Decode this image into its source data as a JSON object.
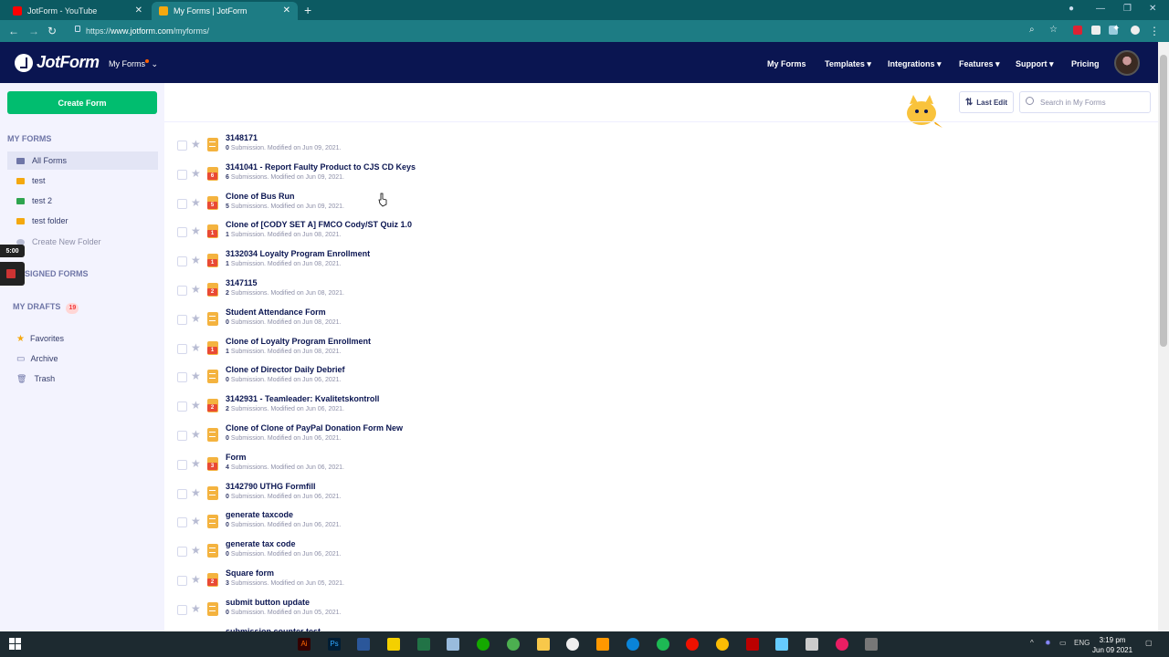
{
  "browser": {
    "tabs": [
      {
        "title": "JotForm - YouTube"
      },
      {
        "title": "My Forms | JotForm"
      }
    ],
    "url_prefix": "https://",
    "url_host": "www.jotform.com",
    "url_path": "/myforms/"
  },
  "header": {
    "logo": "JotForm",
    "myforms_menu": "My Forms",
    "nav": [
      "My Forms",
      "Templates ▾",
      "Integrations ▾",
      "Features ▾",
      "Support ▾",
      "Pricing"
    ]
  },
  "sidebar": {
    "create_label": "Create Form",
    "my_forms_heading": "MY FORMS",
    "all_forms": "All Forms",
    "folders": [
      {
        "label": "test",
        "color": "#f4a80f"
      },
      {
        "label": "test 2",
        "color": "#2ea44f"
      },
      {
        "label": "test folder",
        "color": "#f4a80f"
      }
    ],
    "create_folder": "Create New Folder",
    "assigned_heading": "SIGNED FORMS",
    "drafts_heading": "MY DRAFTS",
    "drafts_count": "19",
    "favorites": "Favorites",
    "archive": "Archive",
    "trash": "Trash",
    "timer": "5:00"
  },
  "toolbar": {
    "sort_label": "Last Edit",
    "search_placeholder": "Search in My Forms"
  },
  "forms": [
    {
      "title": "3148171",
      "count": "0",
      "sub": " Submission. Modified on Jun 09, 2021.",
      "badge": ""
    },
    {
      "title": "3141041 - Report Faulty Product to CJS CD Keys",
      "count": "6",
      "sub": " Submissions. Modified on Jun 09, 2021.",
      "badge": "6"
    },
    {
      "title": "Clone of Bus Run",
      "count": "5",
      "sub": " Submissions. Modified on Jun 09, 2021.",
      "badge": "5"
    },
    {
      "title": "Clone of [CODY SET A] FMCO Cody/ST Quiz 1.0",
      "count": "1",
      "sub": " Submission. Modified on Jun 08, 2021.",
      "badge": "1"
    },
    {
      "title": "3132034 Loyalty Program Enrollment",
      "count": "1",
      "sub": " Submission. Modified on Jun 08, 2021.",
      "badge": "1"
    },
    {
      "title": "3147115",
      "count": "2",
      "sub": " Submissions. Modified on Jun 08, 2021.",
      "badge": "2"
    },
    {
      "title": "Student Attendance Form",
      "count": "0",
      "sub": " Submission. Modified on Jun 08, 2021.",
      "badge": ""
    },
    {
      "title": "Clone of Loyalty Program Enrollment",
      "count": "1",
      "sub": " Submission. Modified on Jun 08, 2021.",
      "badge": "1"
    },
    {
      "title": "Clone of Director Daily Debrief",
      "count": "0",
      "sub": " Submission. Modified on Jun 06, 2021.",
      "badge": ""
    },
    {
      "title": "3142931 - Teamleader: Kvalitetskontroll",
      "count": "2",
      "sub": " Submissions. Modified on Jun 06, 2021.",
      "badge": "2"
    },
    {
      "title": "Clone of Clone of PayPal Donation Form New",
      "count": "0",
      "sub": " Submission. Modified on Jun 06, 2021.",
      "badge": ""
    },
    {
      "title": "Form",
      "count": "4",
      "sub": " Submissions. Modified on Jun 06, 2021.",
      "badge": "3"
    },
    {
      "title": "3142790 UTHG Formfill",
      "count": "0",
      "sub": " Submission. Modified on Jun 06, 2021.",
      "badge": ""
    },
    {
      "title": "generate taxcode",
      "count": "0",
      "sub": " Submission. Modified on Jun 06, 2021.",
      "badge": ""
    },
    {
      "title": "generate tax code",
      "count": "0",
      "sub": " Submission. Modified on Jun 06, 2021.",
      "badge": ""
    },
    {
      "title": "Square form",
      "count": "3",
      "sub": " Submissions. Modified on Jun 05, 2021.",
      "badge": "2"
    },
    {
      "title": "submit button update",
      "count": "0",
      "sub": " Submission. Modified on Jun 05, 2021.",
      "badge": ""
    },
    {
      "title": "submission counter test",
      "count": "",
      "sub": "",
      "badge": ""
    }
  ],
  "taskbar": {
    "time": "3:19 pm",
    "date": "Jun 09 2021",
    "lang": "ENG"
  },
  "colors": {
    "header_bg": "#0a1551",
    "create_btn": "#01bd6f",
    "form_icon": "#f4b33f",
    "badge": "#e94a35"
  }
}
